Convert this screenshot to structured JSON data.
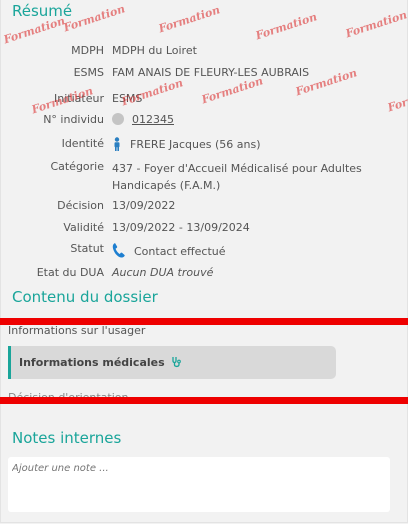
{
  "resume": {
    "title": "Résumé",
    "rows": [
      {
        "label": "MDPH",
        "value": "MDPH du Loiret"
      },
      {
        "label": "ESMS",
        "value": "FAM ANAIS DE FLEURY-LES AUBRAIS"
      },
      {
        "label": "Initiateur",
        "value": "ESMS"
      },
      {
        "label": "N° individu",
        "value": "012345"
      },
      {
        "label": "Identité",
        "value": "FRERE Jacques (56 ans)"
      },
      {
        "label": "Catégorie",
        "value": "437 - Foyer d'Accueil Médicalisé pour Adultes Handicapés (F.A.M.)"
      },
      {
        "label": "Décision",
        "value": "13/09/2022"
      },
      {
        "label": "Validité",
        "value": "13/09/2022 - 13/09/2024"
      },
      {
        "label": "Statut",
        "value": "Contact effectué"
      },
      {
        "label": "Etat du DUA",
        "value": "Aucun DUA trouvé"
      }
    ]
  },
  "contenu": {
    "title": "Contenu du dossier",
    "items": [
      {
        "label": "Informations sur l'usager"
      },
      {
        "label": "Informations médicales"
      },
      {
        "label": "Décision d'orientation"
      }
    ]
  },
  "notes": {
    "title": "Notes internes",
    "placeholder": "Ajouter une note ..."
  },
  "watermark_text": "Formation",
  "colors": {
    "accent": "#1aa59a",
    "redact": "#ee0000",
    "active_bg": "#d9d9d9"
  }
}
